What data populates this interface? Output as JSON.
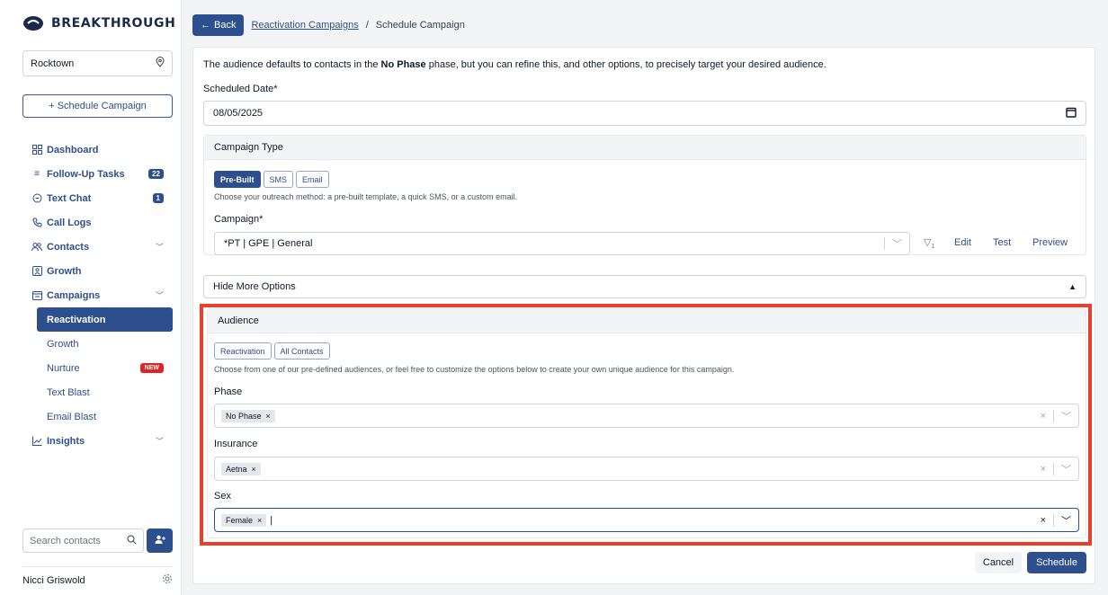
{
  "brand": {
    "name": "BREAKTHROUGH",
    "accent": "#2d4f8e",
    "highlight": "#e8402a"
  },
  "sidebar": {
    "location": "Rocktown",
    "schedule_button": "+ Schedule Campaign",
    "items": [
      {
        "label": "Dashboard",
        "icon": "grid-icon"
      },
      {
        "label": "Follow-Up Tasks",
        "icon": "list-icon",
        "badge": "22"
      },
      {
        "label": "Text Chat",
        "icon": "chat-icon",
        "badge": "1"
      },
      {
        "label": "Call Logs",
        "icon": "phone-icon"
      },
      {
        "label": "Contacts",
        "icon": "users-icon",
        "expandable": true
      },
      {
        "label": "Growth",
        "icon": "growth-icon"
      },
      {
        "label": "Campaigns",
        "icon": "calendar-icon",
        "expandable": true
      }
    ],
    "campaign_sub": [
      {
        "label": "Reactivation",
        "active": true
      },
      {
        "label": "Growth"
      },
      {
        "label": "Nurture",
        "badge": "NEW"
      },
      {
        "label": "Text Blast"
      },
      {
        "label": "Email Blast"
      }
    ],
    "insights": {
      "label": "Insights",
      "icon": "chart-line-icon"
    },
    "search_placeholder": "Search contacts",
    "user_name": "Nicci Griswold"
  },
  "topbar": {
    "back_label": "Back",
    "crumb_link": "Reactivation Campaigns",
    "crumb_sep": "/",
    "crumb_current": "Schedule Campaign"
  },
  "form": {
    "intro_before": "The audience defaults to contacts in the ",
    "intro_bold": "No Phase",
    "intro_after": " phase, but you can refine this, and other options, to precisely target your desired audience.",
    "date_label": "Scheduled Date*",
    "date_value": "08/05/2025",
    "campaign_type": {
      "header": "Campaign Type",
      "options": [
        "Pre-Built",
        "SMS",
        "Email"
      ],
      "help": "Choose your outreach method: a pre-built template, a quick SMS, or a custom email.",
      "campaign_label": "Campaign*",
      "campaign_value": "*PT | GPE | General",
      "filter_count": "1",
      "edit": "Edit",
      "test": "Test",
      "preview": "Preview"
    },
    "more_options": "Hide More Options",
    "audience": {
      "header": "Audience",
      "options": [
        "Reactivation",
        "All Contacts"
      ],
      "help": "Choose from one of our pre-defined audiences, or feel free to customize the options below to create your own unique audience for this campaign.",
      "phase_label": "Phase",
      "phase_tag": "No Phase",
      "insurance_label": "Insurance",
      "insurance_tag": "Aetna",
      "sex_label": "Sex",
      "sex_tag": "Female"
    },
    "cancel": "Cancel",
    "schedule": "Schedule"
  }
}
